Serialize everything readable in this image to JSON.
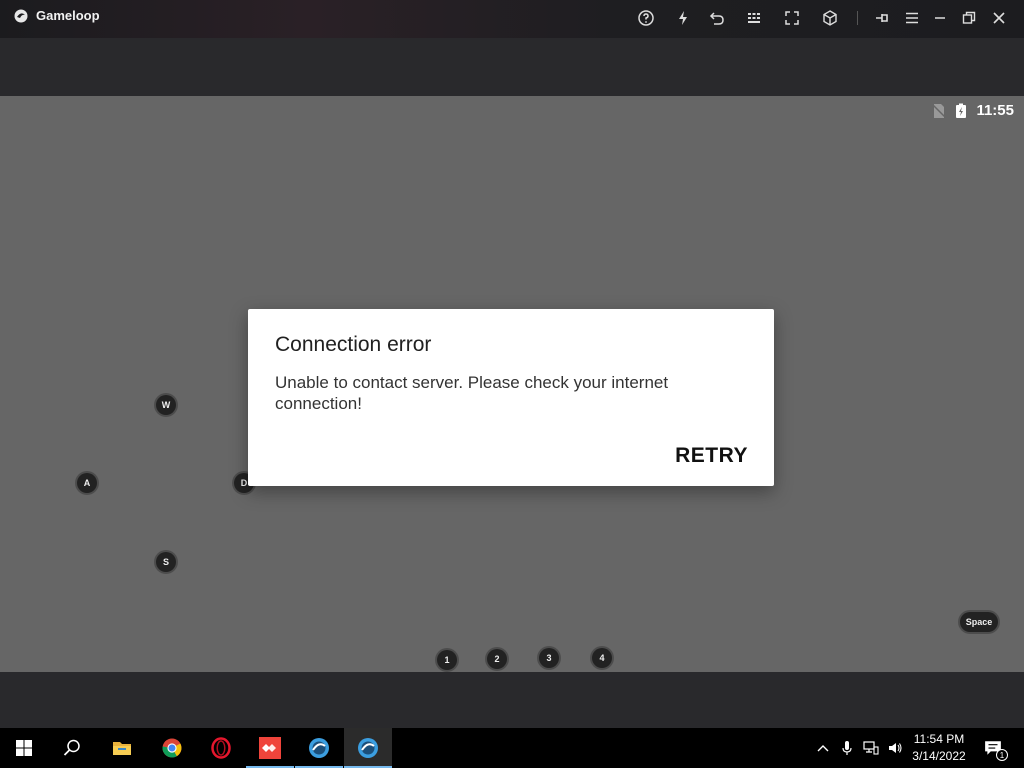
{
  "app": {
    "name": "Gameloop",
    "toolbar_icons": [
      "help-icon",
      "lightning-icon",
      "undo-icon",
      "keyboard-grid-icon",
      "fullscreen-icon",
      "cube-icon",
      "pin-icon",
      "menu-icon",
      "minimize-icon",
      "restore-icon",
      "close-icon"
    ]
  },
  "screen": {
    "status_time": "11:55",
    "keys": {
      "w": "W",
      "a": "A",
      "s": "S",
      "d": "D",
      "k1": "1",
      "k2": "2",
      "k3": "3",
      "k4": "4",
      "space": "Space"
    }
  },
  "dialog": {
    "title": "Connection error",
    "message": "Unable to contact server. Please check your internet connection!",
    "button": "RETRY"
  },
  "taskbar": {
    "apps": [
      "windows-start",
      "search",
      "file-explorer",
      "chrome",
      "opera",
      "anydesk",
      "gameloop",
      "gameloop-active"
    ],
    "time": "11:54 PM",
    "date": "3/14/2022",
    "notification_count": "1",
    "accent": "#76b9ed"
  }
}
